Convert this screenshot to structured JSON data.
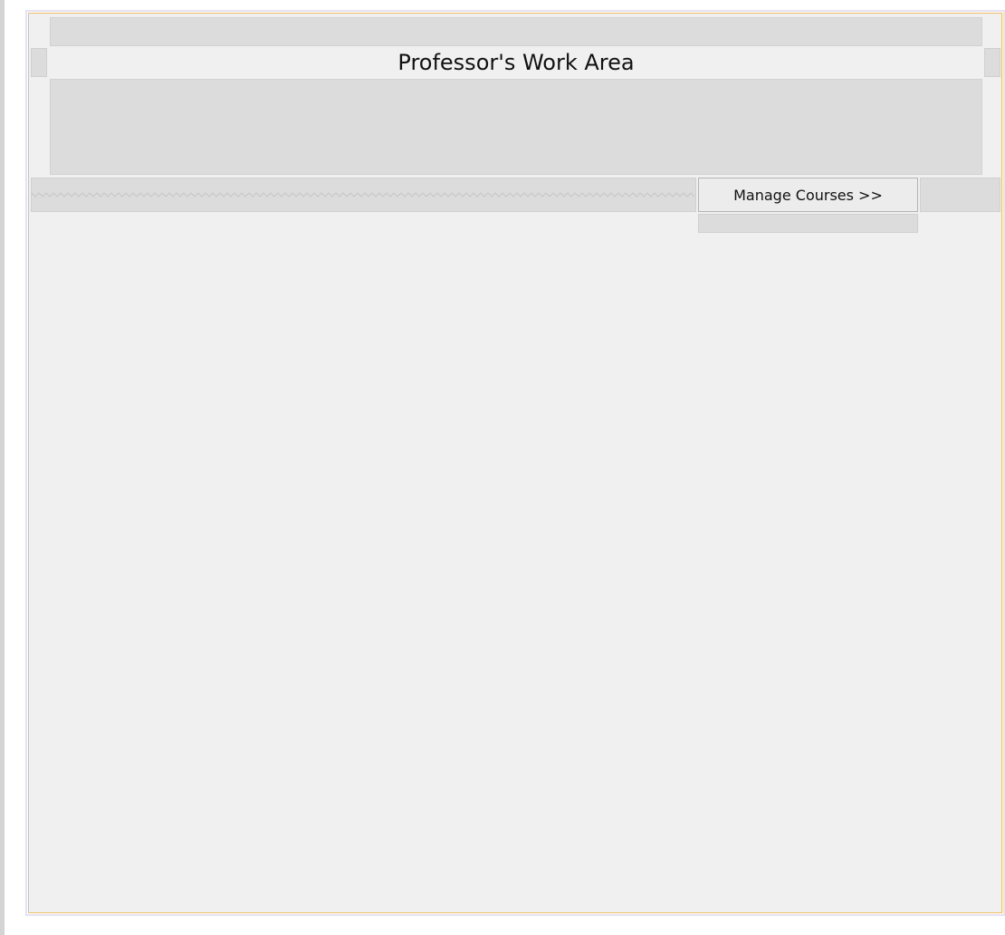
{
  "work_area": {
    "title": "Professor's Work Area",
    "manage_courses_label": "Manage Courses >>"
  },
  "colors": {
    "panel_background": "#f0f0f0",
    "panel_border": "#f0bf63",
    "placeholder_fill": "#dcdcdc"
  }
}
